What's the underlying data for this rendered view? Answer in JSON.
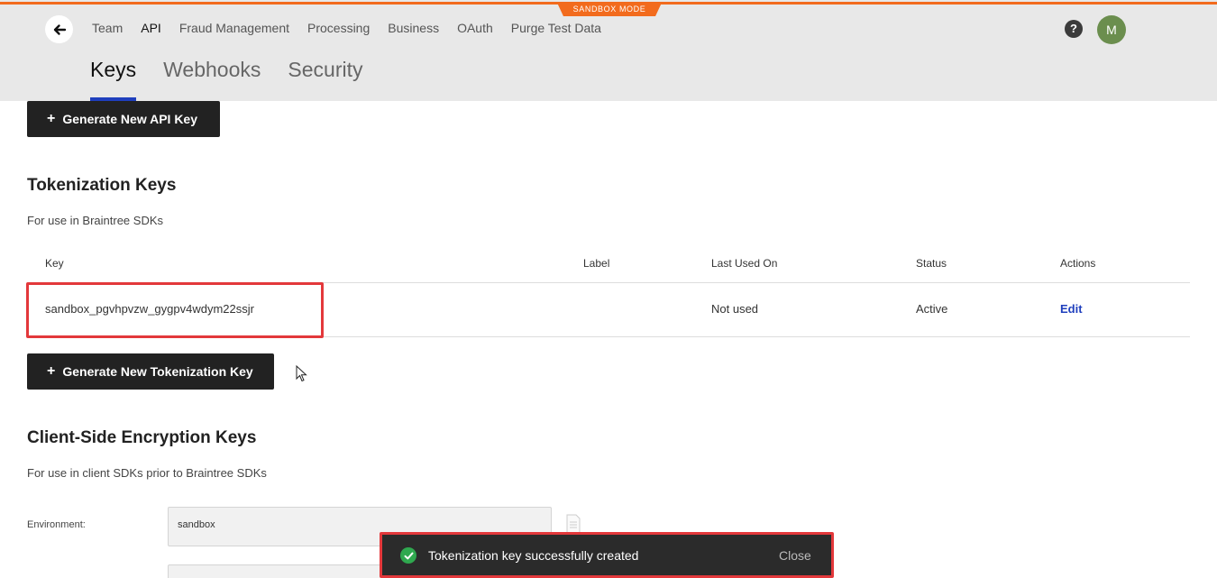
{
  "sandbox_badge": "SANDBOX MODE",
  "top_nav": {
    "items": [
      "Team",
      "API",
      "Fraud Management",
      "Processing",
      "Business",
      "OAuth",
      "Purge Test Data"
    ],
    "active_index": 1
  },
  "help_label": "?",
  "avatar_initial": "M",
  "sub_tabs": {
    "items": [
      "Keys",
      "Webhooks",
      "Security"
    ],
    "active_index": 0
  },
  "api_keys": {
    "generate_button": "Generate New API Key"
  },
  "tokenization": {
    "title": "Tokenization Keys",
    "description": "For use in Braintree SDKs",
    "columns": [
      "Key",
      "Label",
      "Last Used On",
      "Status",
      "Actions"
    ],
    "rows": [
      {
        "key": "sandbox_pgvhpvzw_gygpv4wdym22ssjr",
        "label": "",
        "last_used": "Not used",
        "status": "Active",
        "action": "Edit"
      }
    ],
    "generate_button": "Generate New Tokenization Key"
  },
  "cse": {
    "title": "Client-Side Encryption Keys",
    "description": "For use in client SDKs prior to Braintree SDKs",
    "environment_label": "Environment:",
    "environment_value": "sandbox"
  },
  "toast": {
    "message": "Tokenization key successfully created",
    "close_label": "Close"
  },
  "icons": {
    "plus": "+",
    "back": "arrow-left-icon",
    "success": "check-circle-icon",
    "copy": "document-copy-icon"
  },
  "colors": {
    "sandbox_orange": "#f26b1d",
    "active_tab_underline": "#1f3fbd",
    "highlight_red": "#e3383b",
    "success_green": "#2fa84f",
    "button_dark": "#222222",
    "avatar_green": "#6b8e4e"
  }
}
